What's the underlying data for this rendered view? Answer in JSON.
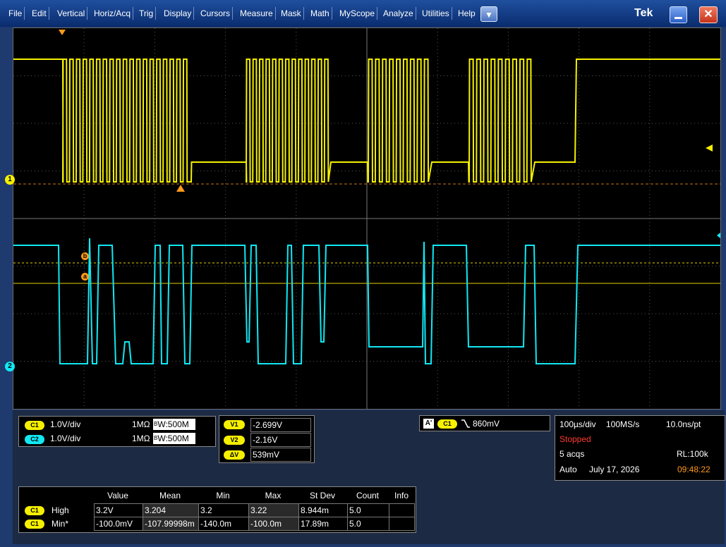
{
  "menu": {
    "items": [
      "File",
      "Edit",
      "Vertical",
      "Horiz/Acq",
      "Trig",
      "Display",
      "Cursors",
      "Measure",
      "Mask",
      "Math",
      "MyScope",
      "Analyze",
      "Utilities",
      "Help"
    ],
    "dropdown_icon": "chevron-down-icon",
    "logo": "Tek"
  },
  "colors": {
    "ch1": "#f5f000",
    "ch2": "#10e8f4",
    "orange": "#ff9a1a"
  },
  "waveform": {
    "ch1_marker": "1",
    "ch2_marker": "2",
    "cursor_b": "b",
    "cursor_a": "a"
  },
  "channels": {
    "ch1": {
      "badge": "C1",
      "scale": "1.0V/div",
      "impedance": "1MΩ",
      "bw_prefix": "B",
      "bw_sub": "W",
      "bw_value": ":500M"
    },
    "ch2": {
      "badge": "C2",
      "scale": "1.0V/div",
      "impedance": "1MΩ",
      "bw_prefix": "B",
      "bw_sub": "W",
      "bw_value": ":500M"
    }
  },
  "cursors": {
    "v1_label": "V1",
    "v1_value": "-2.699V",
    "v2_label": "V2",
    "v2_value": "-2.16V",
    "dv_label": "ΔV",
    "dv_value": "539mV"
  },
  "trigger": {
    "a_label": "A'",
    "channel": "C1",
    "level": "860mV"
  },
  "horizontal": {
    "scale": "100µs/div",
    "sample_rate": "100MS/s",
    "resolution": "10.0ns/pt",
    "state": "Stopped",
    "acqs": "5 acqs",
    "record_length": "RL:100k",
    "mode": "Auto",
    "date": "July 17, 2026",
    "time": "09:48:22"
  },
  "measurements": {
    "headers": [
      "Value",
      "Mean",
      "Min",
      "Max",
      "St Dev",
      "Count",
      "Info"
    ],
    "rows": [
      {
        "badge": "C1",
        "name": "High",
        "cells": [
          "3.2V",
          "3.204",
          "3.2",
          "3.22",
          "8.944m",
          "5.0",
          ""
        ]
      },
      {
        "badge": "C1",
        "name": "Min*",
        "cells": [
          "-100.0mV",
          "-107.99998m",
          "-140.0m",
          "-100.0m",
          "17.89m",
          "5.0",
          ""
        ]
      }
    ]
  }
}
